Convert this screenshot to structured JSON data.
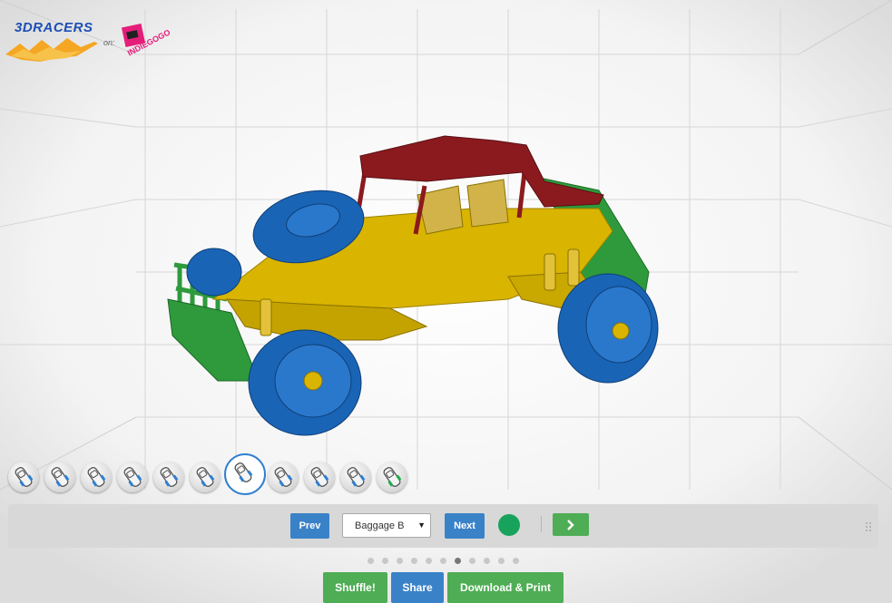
{
  "logo": {
    "brand": "3DRACERS",
    "on": "on:",
    "crowdfund": "INDIEGOGO"
  },
  "colors": {
    "roof": "#8b1a1f",
    "body": "#d9b400",
    "frame": "#2e9a3c",
    "wheels": "#1a64b5",
    "selected_color": "#17a35b",
    "blue_button": "#3a82c8",
    "green_button": "#4fad55"
  },
  "part_strip": {
    "selected_index": 6,
    "items": [
      {
        "icon": "car-nose-part-icon",
        "accent": "#2f7fd0"
      },
      {
        "icon": "car-frame-part-icon",
        "accent": "#2f7fd0"
      },
      {
        "icon": "car-frame-part-icon",
        "accent": "#2f7fd0"
      },
      {
        "icon": "car-frame-part-icon",
        "accent": "#2f7fd0"
      },
      {
        "icon": "car-side-part-icon",
        "accent": "#2f7fd0"
      },
      {
        "icon": "car-rear-part-icon",
        "accent": "#2f7fd0"
      },
      {
        "icon": "car-body-part-icon",
        "accent": "#2f7fd0"
      },
      {
        "icon": "car-wheel-part-icon",
        "accent": "#2f7fd0"
      },
      {
        "icon": "car-wheel-part-icon",
        "accent": "#2f7fd0"
      },
      {
        "icon": "car-cabin-part-icon",
        "accent": "#2f7fd0"
      },
      {
        "icon": "car-roof-part-icon",
        "accent": "#21a84a"
      }
    ]
  },
  "toolbar": {
    "prev_label": "Prev",
    "next_label": "Next",
    "model_selected": "Baggage B",
    "go_icon": "chevron-right-icon"
  },
  "pager": {
    "count": 11,
    "active": 6
  },
  "actions": {
    "shuffle_label": "Shuffle!",
    "share_label": "Share",
    "download_label": "Download & Print"
  }
}
